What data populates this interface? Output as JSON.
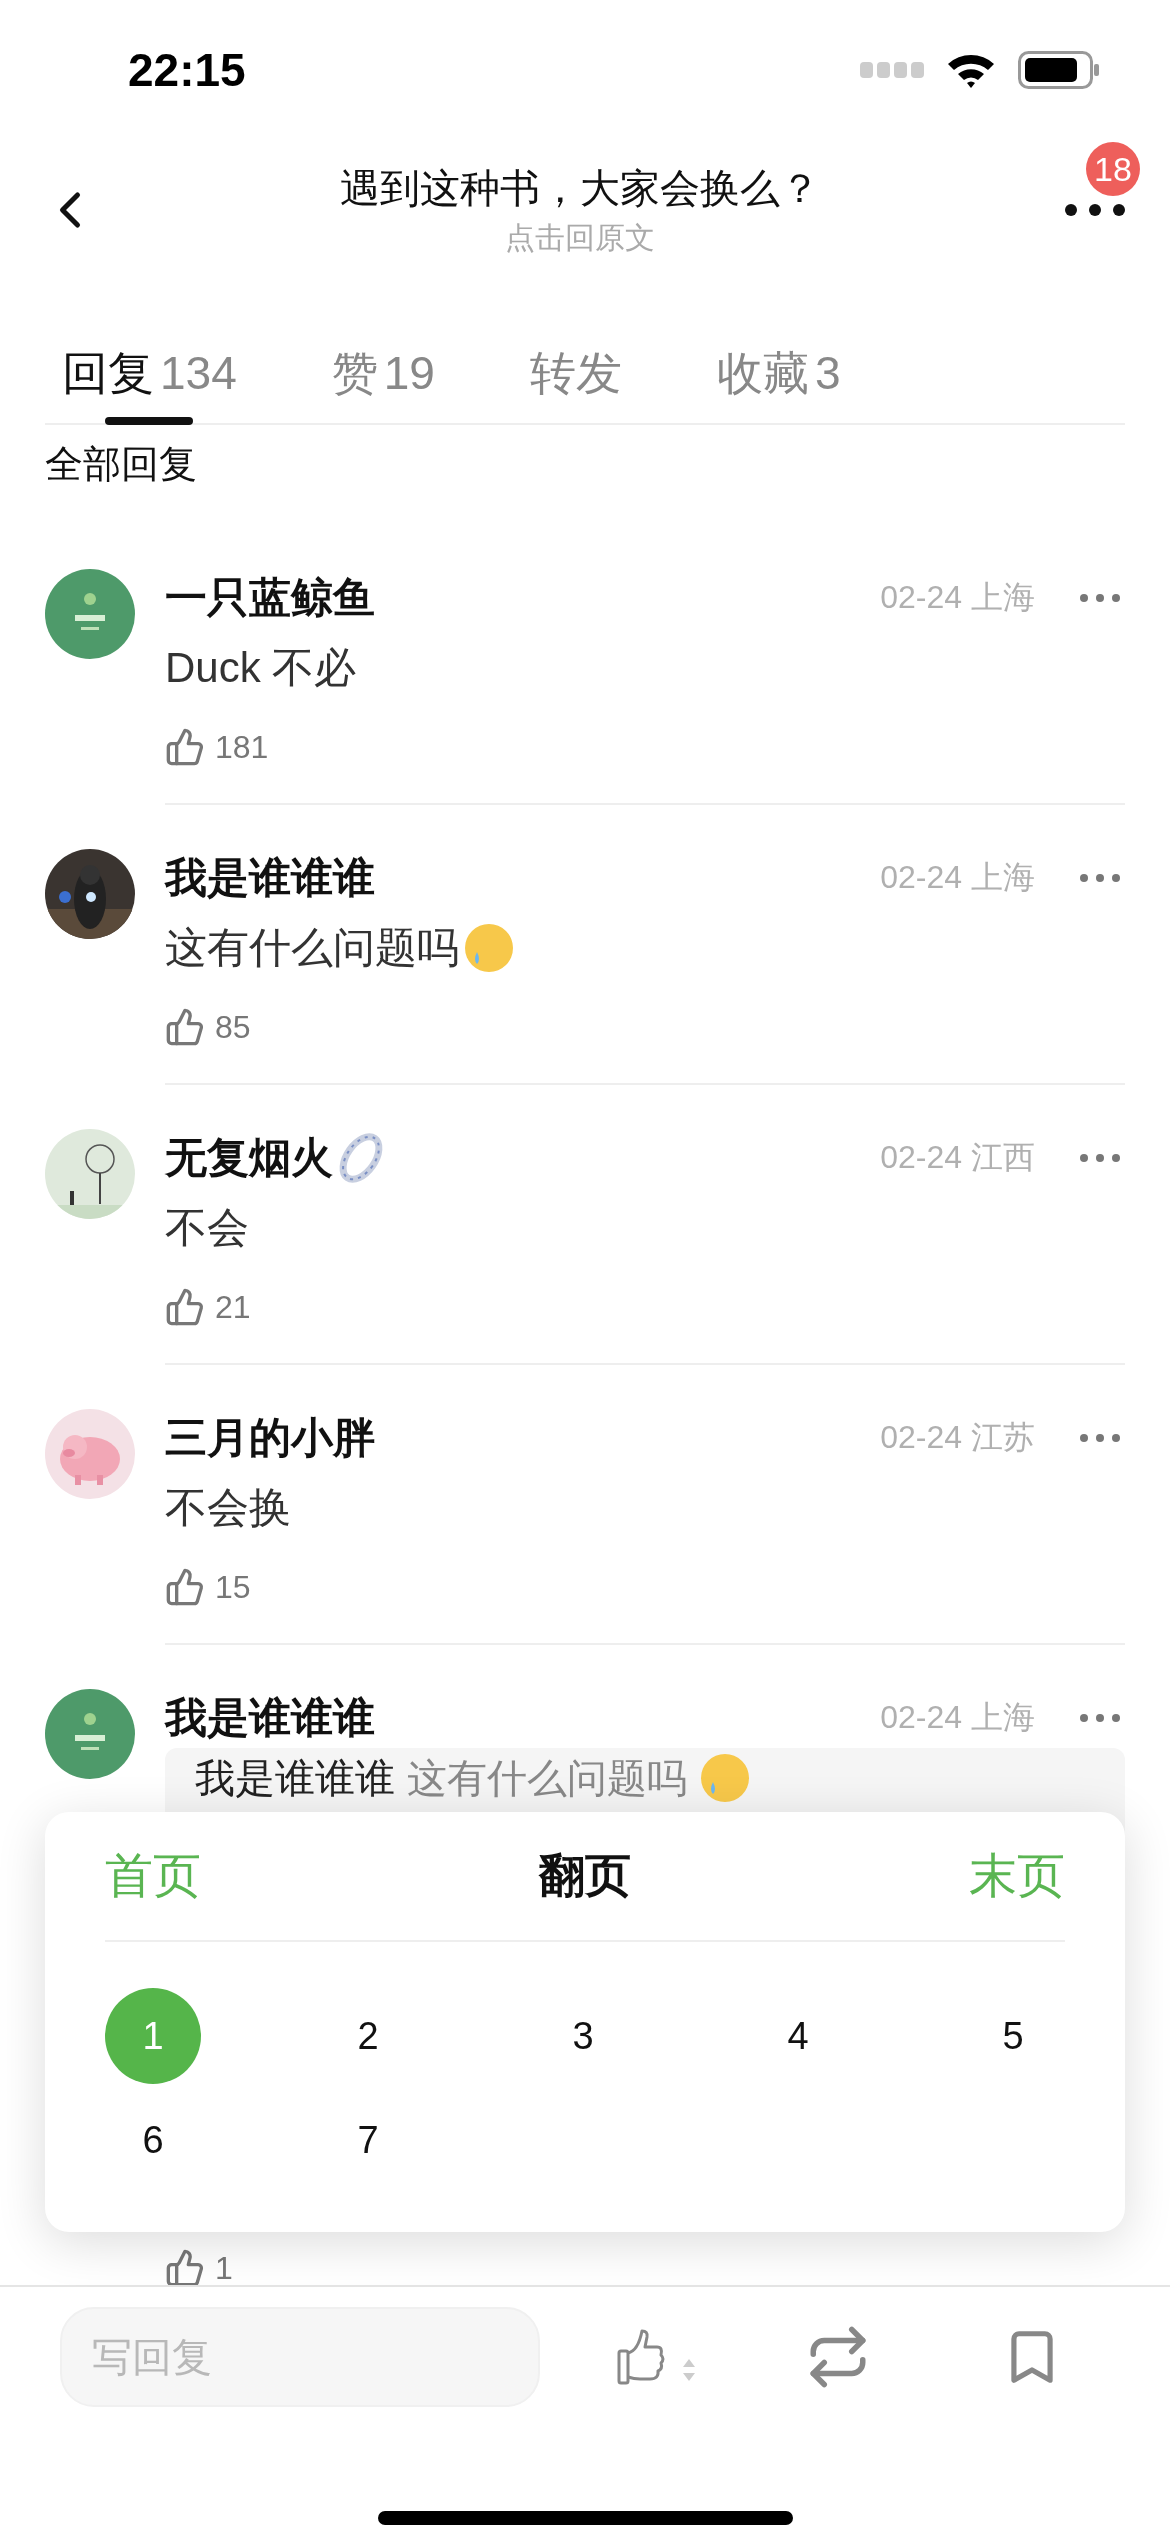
{
  "status_bar": {
    "time": "22:15"
  },
  "nav": {
    "title": "遇到这种书，大家会换么？",
    "subtitle": "点击回原文",
    "badge": "18"
  },
  "tabs": [
    {
      "label": "回复",
      "count": "134",
      "selected": true
    },
    {
      "label": "赞",
      "count": "19",
      "selected": false
    },
    {
      "label": "转发",
      "selected": false
    },
    {
      "label": "收藏",
      "count": "3",
      "selected": false
    }
  ],
  "section_title": "全部回复",
  "comments": [
    {
      "name": "一只蓝鲸鱼",
      "meta": "02-24 上海",
      "text": "Duck 不必",
      "likes": "181"
    },
    {
      "name": "我是谁谁谁",
      "meta": "02-24 上海",
      "text": "这有什么问题吗",
      "text_emoji": true,
      "likes": "85"
    },
    {
      "name": "无复烟火",
      "name_emoji": true,
      "meta": "02-24 江西",
      "text": "不会",
      "likes": "21"
    },
    {
      "name": "三月的小胖",
      "meta": "02-24 江苏",
      "text": "不会换",
      "likes": "15"
    },
    {
      "name": "我是谁谁谁",
      "meta": "02-24 上海",
      "quote": {
        "author": "我是谁谁谁",
        "text": "这有什么问题吗",
        "emoji": true
      },
      "likes": "1"
    }
  ],
  "pager": {
    "first": "首页",
    "title": "翻页",
    "last": "末页",
    "pages": [
      {
        "label": "1",
        "selected": true
      },
      {
        "label": "2",
        "selected": false
      },
      {
        "label": "3",
        "selected": false
      },
      {
        "label": "4",
        "selected": false
      },
      {
        "label": "5",
        "selected": false
      },
      {
        "label": "6",
        "selected": false
      },
      {
        "label": "7",
        "selected": false
      }
    ]
  },
  "bottom_bar": {
    "placeholder": "写回复"
  }
}
